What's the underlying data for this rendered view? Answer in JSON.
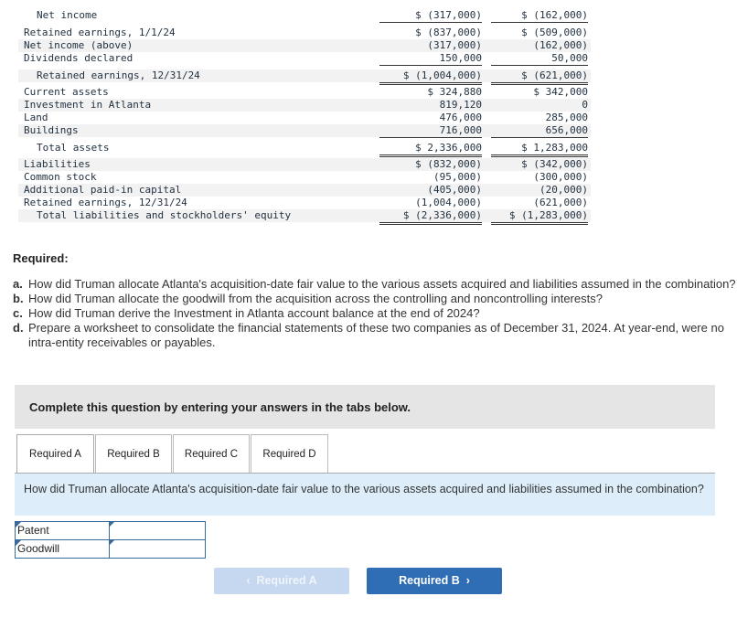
{
  "financials": [
    {
      "label": "Net income",
      "c1": "$ (317,000)",
      "c2": "$ (162,000)",
      "indent": true,
      "gray": false,
      "border": "bb1"
    },
    {
      "label": "Retained earnings, 1/1/24",
      "c1": "$ (837,000)",
      "c2": "$ (509,000)",
      "indent": false,
      "gray": false,
      "border": ""
    },
    {
      "label": "Net income (above)",
      "c1": "(317,000)",
      "c2": "(162,000)",
      "indent": false,
      "gray": true,
      "border": ""
    },
    {
      "label": "Dividends declared",
      "c1": "150,000",
      "c2": "50,000",
      "indent": false,
      "gray": false,
      "border": "bb1"
    },
    {
      "label": "Retained earnings, 12/31/24",
      "c1": "$ (1,004,000)",
      "c2": "$ (621,000)",
      "indent": true,
      "gray": true,
      "border": "bb2"
    },
    {
      "label": "Current assets",
      "c1": "$ 324,880",
      "c2": "$ 342,000",
      "indent": false,
      "gray": false,
      "border": ""
    },
    {
      "label": "Investment in Atlanta",
      "c1": "819,120",
      "c2": "0",
      "indent": false,
      "gray": true,
      "border": ""
    },
    {
      "label": "Land",
      "c1": "476,000",
      "c2": "285,000",
      "indent": false,
      "gray": false,
      "border": ""
    },
    {
      "label": "Buildings",
      "c1": "716,000",
      "c2": "656,000",
      "indent": false,
      "gray": true,
      "border": "bb1"
    },
    {
      "label": "Total assets",
      "c1": "$ 2,336,000",
      "c2": "$ 1,283,000",
      "indent": true,
      "gray": false,
      "border": "bb2"
    },
    {
      "label": "Liabilities",
      "c1": "$ (832,000)",
      "c2": "$ (342,000)",
      "indent": false,
      "gray": true,
      "border": ""
    },
    {
      "label": "Common stock",
      "c1": "(95,000)",
      "c2": "(300,000)",
      "indent": false,
      "gray": false,
      "border": ""
    },
    {
      "label": "Additional paid-in capital",
      "c1": "(405,000)",
      "c2": "(20,000)",
      "indent": false,
      "gray": true,
      "border": ""
    },
    {
      "label": "Retained earnings, 12/31/24",
      "c1": "(1,004,000)",
      "c2": "(621,000)",
      "indent": false,
      "gray": false,
      "border": "bb1"
    },
    {
      "label": "Total liabilities and stockholders' equity",
      "c1": "$ (2,336,000)",
      "c2": "$ (1,283,000)",
      "indent": true,
      "gray": true,
      "border": "bb2"
    }
  ],
  "required": {
    "title": "Required:",
    "items": [
      {
        "letter": "a.",
        "text": "How did Truman allocate Atlanta's acquisition-date fair value to the various assets acquired and liabilities assumed in the combination?"
      },
      {
        "letter": "b.",
        "text": "How did Truman allocate the goodwill from the acquisition across the controlling and noncontrolling interests?"
      },
      {
        "letter": "c.",
        "text": "How did Truman derive the Investment in Atlanta account balance at the end of 2024?"
      },
      {
        "letter": "d.",
        "text": "Prepare a worksheet to consolidate the financial statements of these two companies as of December 31, 2024. At year-end, were no intra-entity receivables or payables."
      }
    ]
  },
  "banner": "Complete this question by entering your answers in the tabs below.",
  "tabs": [
    "Required A",
    "Required B",
    "Required C",
    "Required D"
  ],
  "active_tab": "Required A",
  "question": "How did Truman allocate Atlanta's acquisition-date fair value to the various assets acquired and liabilities assumed in the combination?",
  "answers": [
    {
      "label": "Patent",
      "value": ""
    },
    {
      "label": "Goodwill",
      "value": ""
    }
  ],
  "nav": {
    "prev": "Required A",
    "next": "Required B"
  },
  "colors": {
    "accent": "#2f6eb5",
    "accent_disabled": "#c5d8ef",
    "question_bg": "#ddeefa"
  }
}
